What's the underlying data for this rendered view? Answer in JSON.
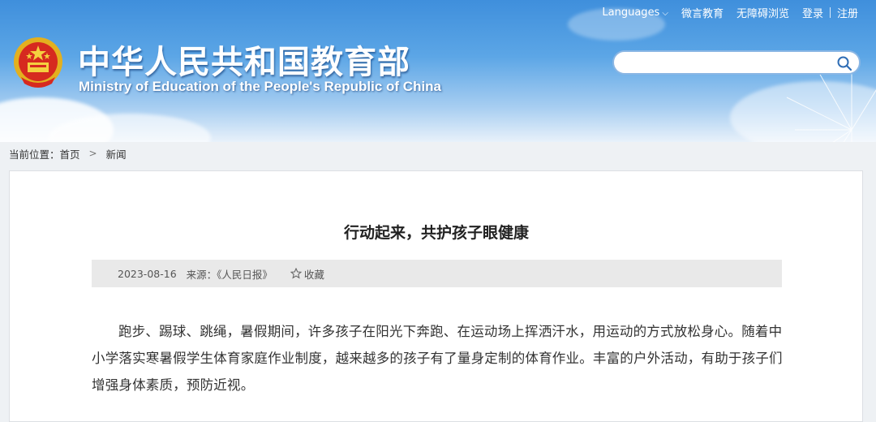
{
  "header": {
    "title_cn": "中华人民共和国教育部",
    "title_en": "Ministry of Education of the People's Republic of China",
    "topbar": {
      "languages": "Languages",
      "weiyan": "微言教育",
      "accessible": "无障碍浏览",
      "login": "登录",
      "register": "注册"
    },
    "search": {
      "value": "",
      "placeholder": ""
    }
  },
  "breadcrumb": {
    "prefix": "当前位置：",
    "home": "首页",
    "section": "新闻"
  },
  "article": {
    "title": "行动起来，共护孩子眼健康",
    "date": "2023-08-16",
    "source": "来源：《人民日报》",
    "favorite": "收藏",
    "body": "跑步、踢球、跳绳，暑假期间，许多孩子在阳光下奔跑、在运动场上挥洒汗水，用运动的方式放松身心。随着中小学落实寒暑假学生体育家庭作业制度，越来越多的孩子有了量身定制的体育作业。丰富的户外活动，有助于孩子们增强身体素质，预防近视。"
  },
  "icons": {
    "emblem": "national-emblem-icon",
    "search": "search-icon",
    "chevron": "chevron-down-icon",
    "breadcrumb_arrow": "chevron-right-icon",
    "favorite": "star-outline-icon"
  },
  "colors": {
    "header_top": "#3f8fdc",
    "meta_bar": "#e9e9e9",
    "search_border": "#8ab6e4"
  }
}
